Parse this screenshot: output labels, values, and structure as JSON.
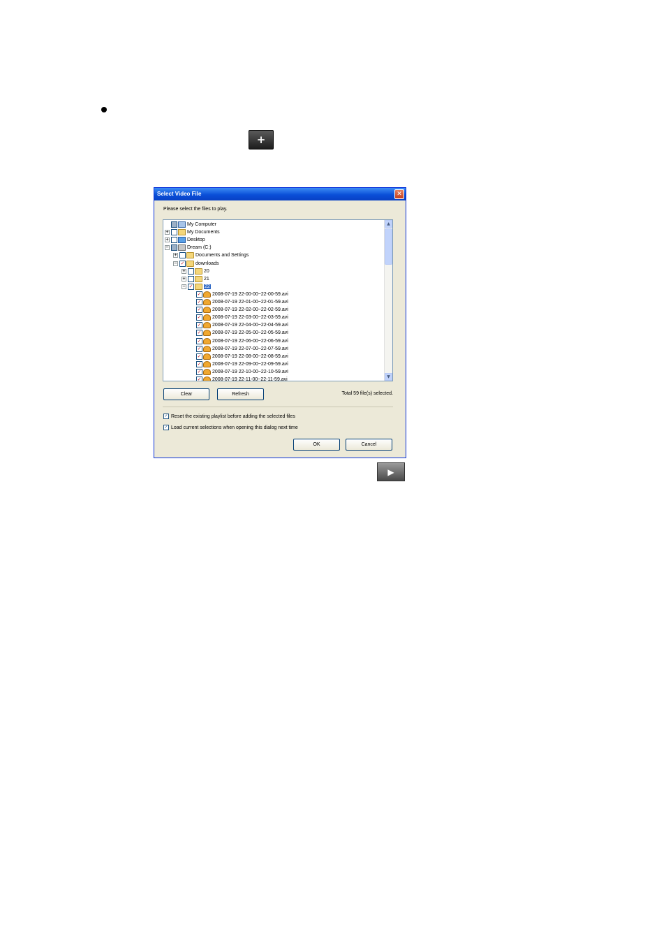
{
  "page": {
    "add_button_label": "+",
    "play_button_label": "▶"
  },
  "dialog": {
    "title": "Select Video File",
    "close_label": "✕",
    "prompt": "Please select the files to play.",
    "tree": {
      "items": [
        {
          "label": "My Computer",
          "icon": "computer-icon",
          "expander": "",
          "checkbox": "partial"
        },
        {
          "label": "My Documents",
          "icon": "documents-folder-icon",
          "expander": "+",
          "checkbox": "unchecked"
        },
        {
          "label": "Desktop",
          "icon": "desktop-icon",
          "expander": "+",
          "checkbox": "unchecked"
        },
        {
          "label": "Dream (C:)",
          "icon": "drive-icon",
          "expander": "−",
          "checkbox": "partial"
        },
        {
          "label": "Documents and Settings",
          "icon": "folder-icon",
          "expander": "+",
          "checkbox": "unchecked"
        },
        {
          "label": "downloads",
          "icon": "folder-icon",
          "expander": "−",
          "checkbox": "checked"
        },
        {
          "label": "20",
          "icon": "folder-icon",
          "expander": "+",
          "checkbox": "unchecked"
        },
        {
          "label": "21",
          "icon": "folder-icon",
          "expander": "+",
          "checkbox": "unchecked"
        },
        {
          "label": "22",
          "icon": "folder-icon",
          "expander": "−",
          "checkbox": "checked",
          "selected": true
        },
        {
          "label": "2008-07-19 22-00-00~22-00-59.avi",
          "icon": "video-file-icon",
          "expander": "",
          "checkbox": "checked"
        },
        {
          "label": "2008-07-19 22-01-00~22-01-59.avi",
          "icon": "video-file-icon",
          "expander": "",
          "checkbox": "checked"
        },
        {
          "label": "2008-07-19 22-02-00~22-02-59.avi",
          "icon": "video-file-icon",
          "expander": "",
          "checkbox": "checked"
        },
        {
          "label": "2008-07-19 22-03-00~22-03-59.avi",
          "icon": "video-file-icon",
          "expander": "",
          "checkbox": "checked"
        },
        {
          "label": "2008-07-19 22-04-00~22-04-59.avi",
          "icon": "video-file-icon",
          "expander": "",
          "checkbox": "checked"
        },
        {
          "label": "2008-07-19 22-05-00~22-05-59.avi",
          "icon": "video-file-icon",
          "expander": "",
          "checkbox": "checked"
        },
        {
          "label": "2008-07-19 22-06-00~22-06-59.avi",
          "icon": "video-file-icon",
          "expander": "",
          "checkbox": "checked"
        },
        {
          "label": "2008-07-19 22-07-00~22-07-59.avi",
          "icon": "video-file-icon",
          "expander": "",
          "checkbox": "checked"
        },
        {
          "label": "2008-07-19 22-08-00~22-08-59.avi",
          "icon": "video-file-icon",
          "expander": "",
          "checkbox": "checked"
        },
        {
          "label": "2008-07-19 22-09-00~22-09-59.avi",
          "icon": "video-file-icon",
          "expander": "",
          "checkbox": "checked"
        },
        {
          "label": "2008-07-19 22-10-00~22-10-59.avi",
          "icon": "video-file-icon",
          "expander": "",
          "checkbox": "checked"
        },
        {
          "label": "2008-07-19 22-11-00~22-11-59.avi",
          "icon": "video-file-icon",
          "expander": "",
          "checkbox": "checked"
        }
      ]
    },
    "scroll_up_label": "▲",
    "scroll_down_label": "▼",
    "clear_label": "Clear",
    "refresh_label": "Refresh",
    "status_text": "Total 59 file(s) selected.",
    "option_reset": {
      "label": "Reset the existing playlist before adding the selected files",
      "checked": true
    },
    "option_load": {
      "label": "Load current selections when opening this dialog next time",
      "checked": true
    },
    "ok_label": "OK",
    "cancel_label": "Cancel"
  }
}
